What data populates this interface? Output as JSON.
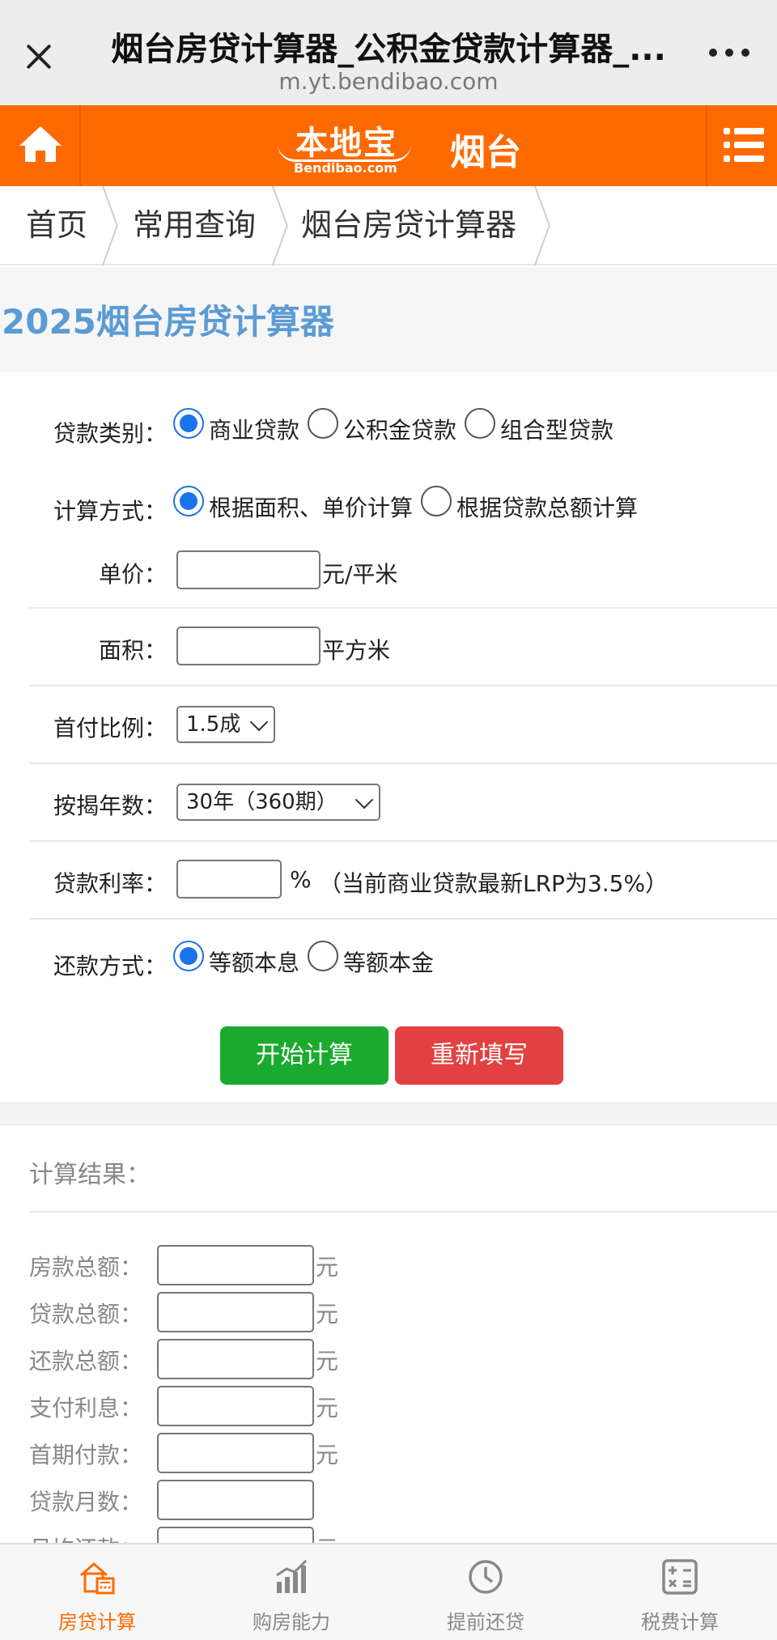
{
  "browser": {
    "title": "烟台房贷计算器_公积金贷款计算器_...",
    "url": "m.yt.bendibao.com"
  },
  "header": {
    "logo_cn": "本地宝",
    "logo_en": "Bendibao.com",
    "city": "烟台",
    "brand_color": "#ff6a00"
  },
  "breadcrumb": [
    "首页",
    "常用查询",
    "烟台房贷计算器"
  ],
  "page_title": "2025烟台房贷计算器",
  "form": {
    "loan_type": {
      "label": "贷款类别：",
      "options": [
        "商业贷款",
        "公积金贷款",
        "组合型贷款"
      ],
      "selected": "商业贷款"
    },
    "calc_method": {
      "label": "计算方式：",
      "options": [
        "根据面积、单价计算",
        "根据贷款总额计算"
      ],
      "selected": "根据面积、单价计算"
    },
    "unit_price": {
      "label": "单价：",
      "value": "",
      "unit": "元/平米"
    },
    "area": {
      "label": "面积：",
      "value": "",
      "unit": "平方米"
    },
    "down_payment": {
      "label": "首付比例：",
      "selected": "1.5成"
    },
    "years": {
      "label": "按揭年数：",
      "selected": "30年（360期）"
    },
    "rate": {
      "label": "贷款利率：",
      "value": "",
      "unit": "%",
      "note": "（当前商业贷款最新LRP为3.5%）"
    },
    "repay_method": {
      "label": "还款方式：",
      "options": [
        "等额本息",
        "等额本金"
      ],
      "selected": "等额本息"
    },
    "buttons": {
      "calculate": "开始计算",
      "reset": "重新填写"
    }
  },
  "results": {
    "title": "计算结果：",
    "rows": [
      {
        "label": "房款总额：",
        "value": "",
        "unit": "元"
      },
      {
        "label": "贷款总额：",
        "value": "",
        "unit": "元"
      },
      {
        "label": "还款总额：",
        "value": "",
        "unit": "元"
      },
      {
        "label": "支付利息：",
        "value": "",
        "unit": "元"
      },
      {
        "label": "首期付款：",
        "value": "",
        "unit": "元"
      },
      {
        "label": "贷款月数：",
        "value": "",
        "unit": ""
      },
      {
        "label": "月均还款：",
        "value": "",
        "unit": "元"
      }
    ]
  },
  "bottom_nav": {
    "items": [
      "房贷计算",
      "购房能力",
      "提前还贷",
      "税费计算"
    ],
    "active": "房贷计算"
  }
}
